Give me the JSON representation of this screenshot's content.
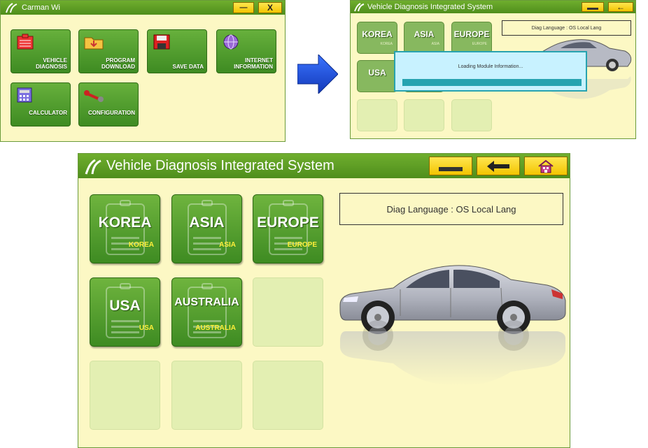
{
  "win1": {
    "title": "Carman Wi",
    "minimize_label": "—",
    "close_label": "X",
    "tiles": [
      {
        "label": "VEHICLE DIAGNOSIS",
        "icon": "vehicle-diagnosis-icon"
      },
      {
        "label": "PROGRAM DOWNLOAD",
        "icon": "folder-download-icon"
      },
      {
        "label": "SAVE DATA",
        "icon": "floppy-disk-icon"
      },
      {
        "label": "INTERNET INFORMATION",
        "icon": "globe-icon"
      },
      {
        "label": "CALCULATOR",
        "icon": "calculator-icon"
      },
      {
        "label": "CONFIGURATION",
        "icon": "wrench-icon"
      }
    ]
  },
  "arrow": {
    "icon": "right-arrow-icon",
    "color": "#1a4ed6"
  },
  "win2": {
    "title": "Vehicle Diagnosis Integrated System",
    "diag_language": "Diag Language : OS Local Lang",
    "regions": [
      {
        "big": "KOREA",
        "small": "KOREA"
      },
      {
        "big": "ASIA",
        "small": "ASIA"
      },
      {
        "big": "EUROPE",
        "small": "EUROPE"
      },
      {
        "big": "USA",
        "small": "USA"
      }
    ],
    "loading_text": "Loading Module Information..."
  },
  "win3": {
    "title": "Vehicle Diagnosis Integrated System",
    "diag_language": "Diag Language : OS Local Lang",
    "regions": [
      {
        "big": "KOREA",
        "small": "KOREA"
      },
      {
        "big": "ASIA",
        "small": "ASIA"
      },
      {
        "big": "EUROPE",
        "small": "EUROPE"
      },
      {
        "big": "USA",
        "small": "USA"
      },
      {
        "big": "AUSTRALIA",
        "small": "AUSTRALIA"
      }
    ],
    "buttons": [
      "minimize-button",
      "back-button",
      "home-button"
    ]
  },
  "colors": {
    "title_green": "#4f8e1c",
    "panel_bg": "#fcf8c4",
    "tile_green": "#3e8b22",
    "button_yellow": "#f3c400",
    "region_sub_yellow": "#ffef3a",
    "car_silver": "#b7bac4"
  }
}
